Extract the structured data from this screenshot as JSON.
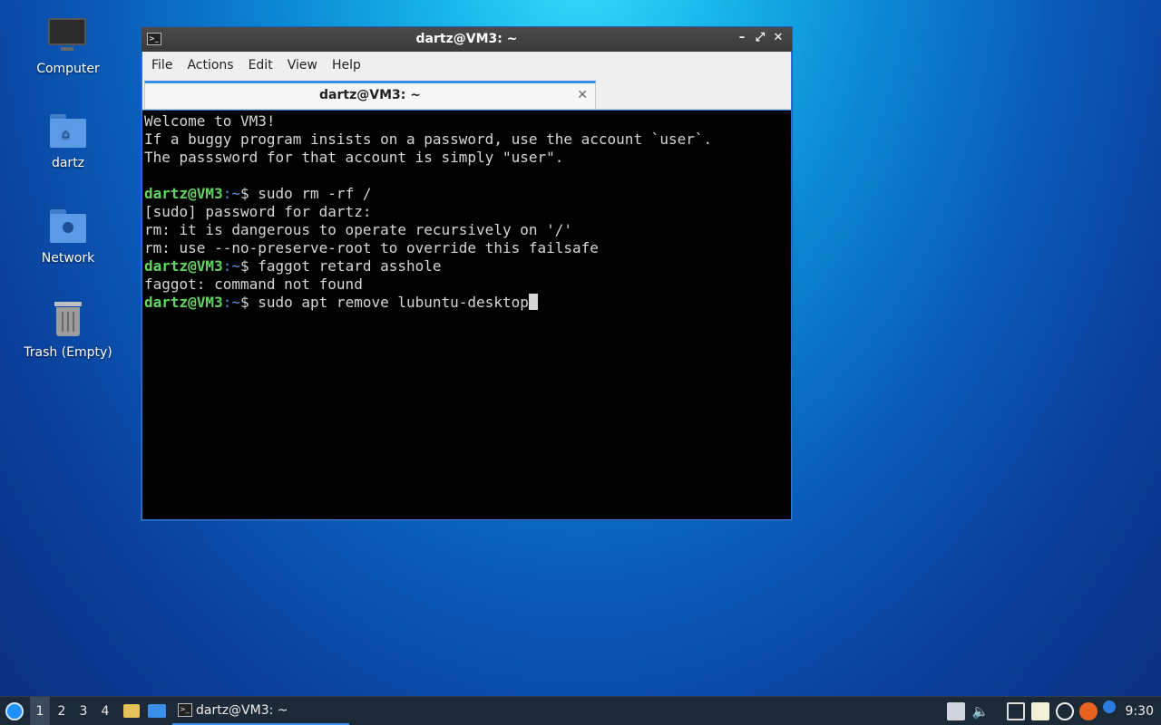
{
  "desktop": {
    "icons": [
      {
        "label": "Computer",
        "icon": "computer-icon"
      },
      {
        "label": "dartz",
        "icon": "home-folder-icon"
      },
      {
        "label": "Network",
        "icon": "network-folder-icon"
      },
      {
        "label": "Trash (Empty)",
        "icon": "trash-icon"
      }
    ]
  },
  "window": {
    "title": "dartz@VM3: ~",
    "controls": {
      "minimize": "–",
      "maximize": "⤢",
      "close": "✕"
    },
    "menu": [
      "File",
      "Actions",
      "Edit",
      "View",
      "Help"
    ],
    "tab": {
      "label": "dartz@VM3: ~",
      "close": "✕"
    }
  },
  "terminal": {
    "lines": [
      {
        "text": "Welcome to VM3!"
      },
      {
        "text": "If a buggy program insists on a password, use the account `user`."
      },
      {
        "text": "The passsword for that account is simply \"user\"."
      },
      {
        "text": ""
      },
      {
        "user": "dartz@VM3",
        "path": ":~",
        "cmd": "$ sudo rm -rf /"
      },
      {
        "text": "[sudo] password for dartz:"
      },
      {
        "text": "rm: it is dangerous to operate recursively on '/'"
      },
      {
        "text": "rm: use --no-preserve-root to override this failsafe"
      },
      {
        "user": "dartz@VM3",
        "path": ":~",
        "cmd": "$ faggot retard asshole"
      },
      {
        "text": "faggot: command not found"
      },
      {
        "user": "dartz@VM3",
        "path": ":~",
        "cmd": "$ sudo apt remove lubuntu-desktop"
      }
    ],
    "colors": {
      "background": "#000000",
      "foreground": "#d6d6d6",
      "prompt_user": "#5fd75f",
      "prompt_path": "#5c8ddb"
    }
  },
  "taskbar": {
    "workspaces": [
      "1",
      "2",
      "3",
      "4"
    ],
    "active_workspace": "1",
    "task_label": "dartz@VM3: ~",
    "tray_icons": [
      "menu-icon",
      "volume-icon",
      "network-icon",
      "clipboard-icon",
      "settings-icon",
      "update-icon",
      "notification-icon"
    ],
    "clock": "9:30"
  }
}
